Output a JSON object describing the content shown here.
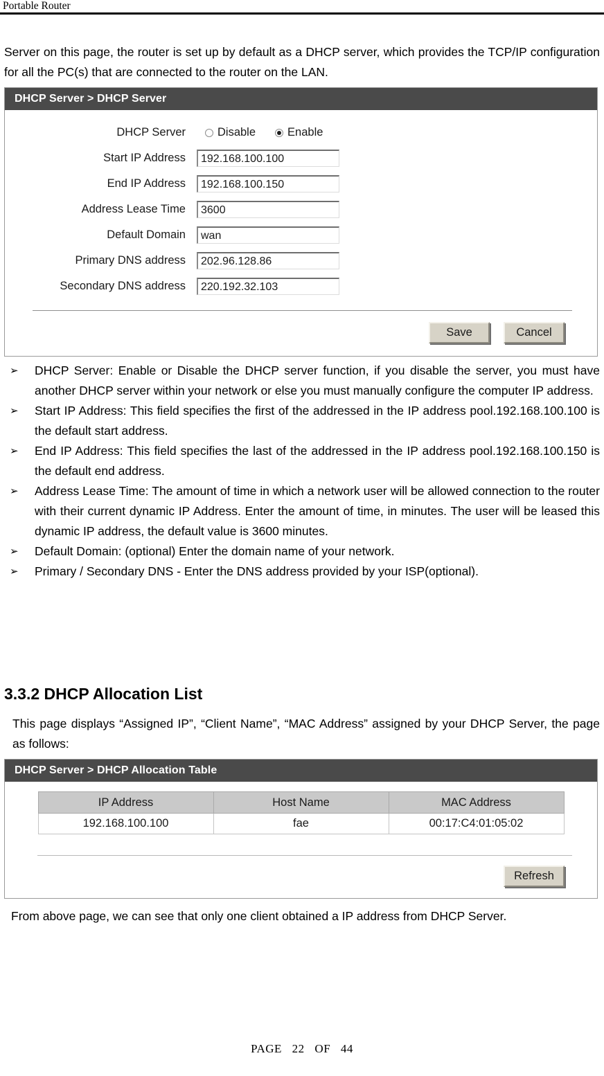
{
  "header": {
    "running_title": "Portable Router"
  },
  "intro_paragraph": "Server on this page, the router is set up by default as a DHCP server, which provides the TCP/IP configuration for all the PC(s) that are connected to the router on the LAN.",
  "dhcp_server_panel": {
    "title": "DHCP Server > DHCP Server",
    "rows": [
      {
        "label": "DHCP Server"
      },
      {
        "label": "Start IP Address",
        "value": "192.168.100.100"
      },
      {
        "label": "End IP Address",
        "value": "192.168.100.150"
      },
      {
        "label": "Address Lease Time",
        "value": "3600"
      },
      {
        "label": "Default Domain",
        "value": "wan"
      },
      {
        "label": "Primary DNS address",
        "value": "202.96.128.86"
      },
      {
        "label": "Secondary DNS address",
        "value": "220.192.32.103"
      }
    ],
    "radio_disable_label": "Disable",
    "radio_enable_label": "Enable",
    "radio_selected": "Enable",
    "save_label": "Save",
    "cancel_label": "Cancel"
  },
  "bullets": [
    {
      "marker": "➢",
      "text": "DHCP Server: Enable or Disable the DHCP server function, if you disable the server, you must have another DHCP server within your network or else you must manually configure the computer IP address."
    },
    {
      "marker": "➢",
      "text": "Start IP Address: This field specifies the first of the addressed in the IP address pool.192.168.100.100 is the default start address."
    },
    {
      "marker": "➢",
      "text": "End IP Address: This field specifies the last of the addressed in the IP address pool.192.168.100.150 is the default end address."
    },
    {
      "marker": "➢",
      "text": "Address Lease Time: The amount of time in which a network user will be allowed connection to the router with their current dynamic IP Address. Enter the amount of time, in minutes. The user will be leased this dynamic IP address, the default value is 3600 minutes."
    },
    {
      "marker": "➢",
      "text": "Default Domain: (optional) Enter the domain name of your network."
    },
    {
      "marker": "➢",
      "text": "Primary / Secondary DNS - Enter the DNS address provided by your ISP(optional)."
    }
  ],
  "section": {
    "heading": "3.3.2 DHCP Allocation List",
    "paragraph": "This page displays “Assigned IP”, “Client Name”, “MAC Address” assigned by your DHCP Server, the page as follows:"
  },
  "allocation_panel": {
    "title": "DHCP Server > DHCP Allocation Table",
    "columns": [
      "IP Address",
      "Host Name",
      "MAC Address"
    ],
    "rows": [
      [
        "192.168.100.100",
        "fae",
        "00:17:C4:01:05:02"
      ]
    ],
    "refresh_label": "Refresh"
  },
  "closing_paragraph": "From above page, we can see that only one client obtained a IP address from DHCP Server.",
  "footer": {
    "page_word": "PAGE",
    "page_number": "22",
    "of_word": "OF",
    "total_pages": "44"
  },
  "colors": {
    "panel_title_bar": "#4a4a4a",
    "button_face": "#d7d3c7",
    "table_header": "#c9c9c9"
  }
}
